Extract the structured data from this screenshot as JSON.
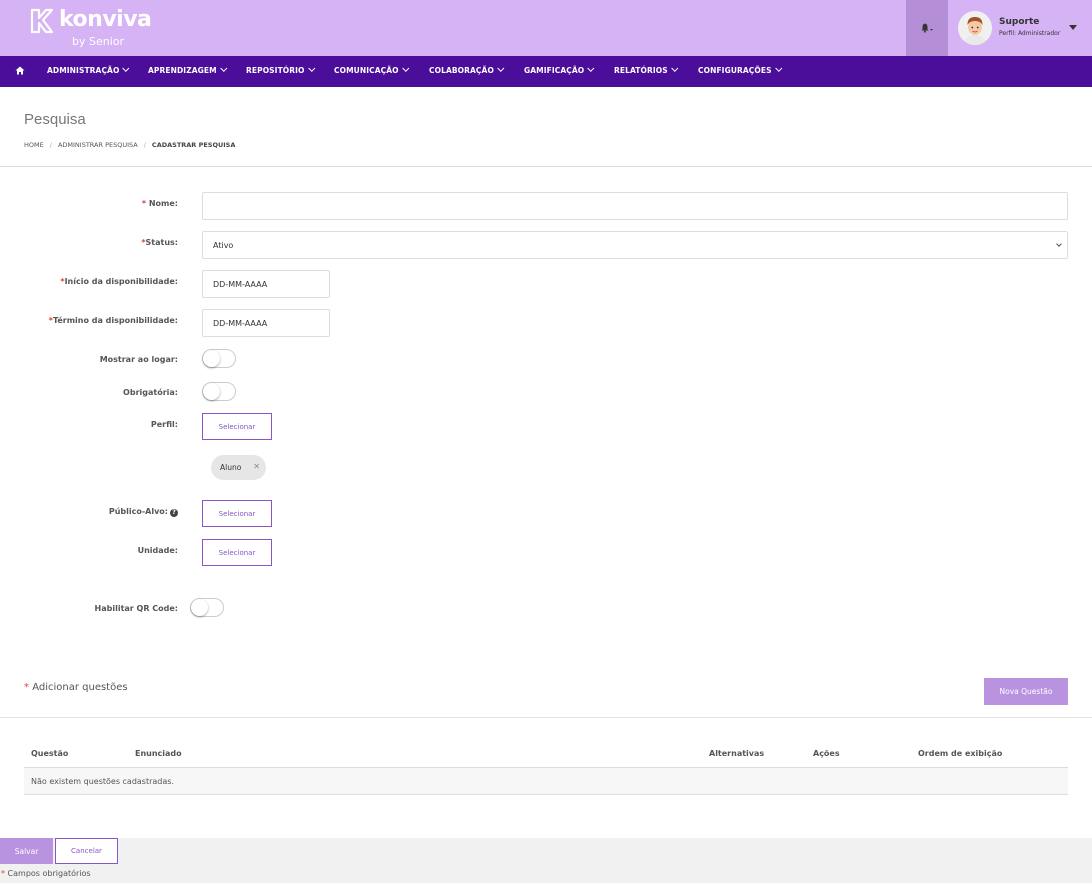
{
  "header": {
    "brand": "konviva",
    "brand_by": "by Senior",
    "user_name": "Suporte",
    "user_profile": "Perfil: Administrador",
    "colors": {
      "header_bg": "#d6b3f5",
      "nav_bg": "#4b0e9a",
      "accent": "#8a55c9",
      "required": "#d9433a"
    }
  },
  "nav": {
    "home_icon": "home-icon",
    "items": [
      "ADMINISTRAÇÃO",
      "APRENDIZAGEM",
      "REPOSITÓRIO",
      "COMUNICAÇÃO",
      "COLABORAÇÃO",
      "GAMIFICAÇÃO",
      "RELATÓRIOS",
      "CONFIGURAÇÕES"
    ]
  },
  "page": {
    "title": "Pesquisa",
    "breadcrumb": [
      "HOME",
      "ADMINISTRAR PESQUISA",
      "CADASTRAR PESQUISA"
    ]
  },
  "form": {
    "nome_label": "Nome:",
    "nome_value": "",
    "status_label": "Status:",
    "status_value": "Ativo",
    "inicio_label": "Início da disponibilidade:",
    "inicio_placeholder": "DD-MM-AAAA",
    "termino_label": "Término da disponibilidade:",
    "termino_placeholder": "DD-MM-AAAA",
    "mostrar_label": "Mostrar ao logar:",
    "mostrar_on": false,
    "obrigatoria_label": "Obrigatória:",
    "obrigatoria_on": false,
    "perfil_label": "Perfil:",
    "selecionar": "Selecionar",
    "perfil_chip": "Aluno",
    "publico_label": "Público-Alvo:",
    "unidade_label": "Unidade:",
    "qr_label": "Habilitar QR Code:",
    "qr_on": false,
    "required_mark": "*"
  },
  "questions": {
    "title": "Adicionar questões",
    "new_button": "Nova Questão",
    "columns": [
      "Questão",
      "Enunciado",
      "Alternativas",
      "Ações",
      "Ordem de exibição"
    ],
    "empty_text": "Não existem questões cadastradas."
  },
  "footer": {
    "save": "Salvar",
    "cancel": "Cancelar",
    "note": "Campos obrigatórios"
  }
}
